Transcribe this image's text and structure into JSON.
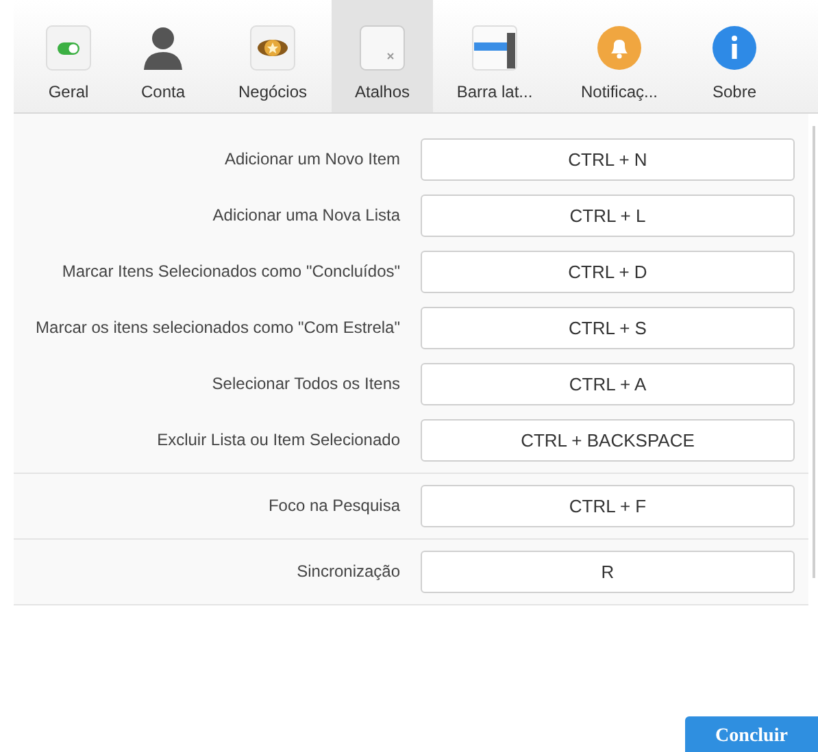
{
  "tabs": [
    {
      "label": "Geral",
      "kind": "toggle",
      "selected": false
    },
    {
      "label": "Conta",
      "kind": "person",
      "selected": false
    },
    {
      "label": "Negócios",
      "kind": "badge",
      "selected": false
    },
    {
      "label": "Atalhos",
      "kind": "keys",
      "selected": true
    },
    {
      "label": "Barra lat...",
      "kind": "sidebar",
      "selected": false
    },
    {
      "label": "Notificaç...",
      "kind": "bell",
      "selected": false
    },
    {
      "label": "Sobre",
      "kind": "info",
      "selected": false
    }
  ],
  "sections": [
    [
      {
        "action": "Adicionar um Novo Item",
        "shortcut": "CTRL + N"
      },
      {
        "action": "Adicionar uma Nova Lista",
        "shortcut": "CTRL + L"
      },
      {
        "action": "Marcar Itens Selecionados como \"Concluídos\"",
        "shortcut": "CTRL + D"
      },
      {
        "action": "Marcar os itens selecionados como \"Com Estrela\"",
        "shortcut": "CTRL + S"
      },
      {
        "action": "Selecionar Todos os Itens",
        "shortcut": "CTRL + A"
      },
      {
        "action": "Excluir Lista ou Item Selecionado",
        "shortcut": "CTRL + BACKSPACE"
      }
    ],
    [
      {
        "action": "Foco na Pesquisa",
        "shortcut": "CTRL + F"
      }
    ],
    [
      {
        "action": "Sincronização",
        "shortcut": "R"
      }
    ]
  ],
  "done_button": "Concluir"
}
